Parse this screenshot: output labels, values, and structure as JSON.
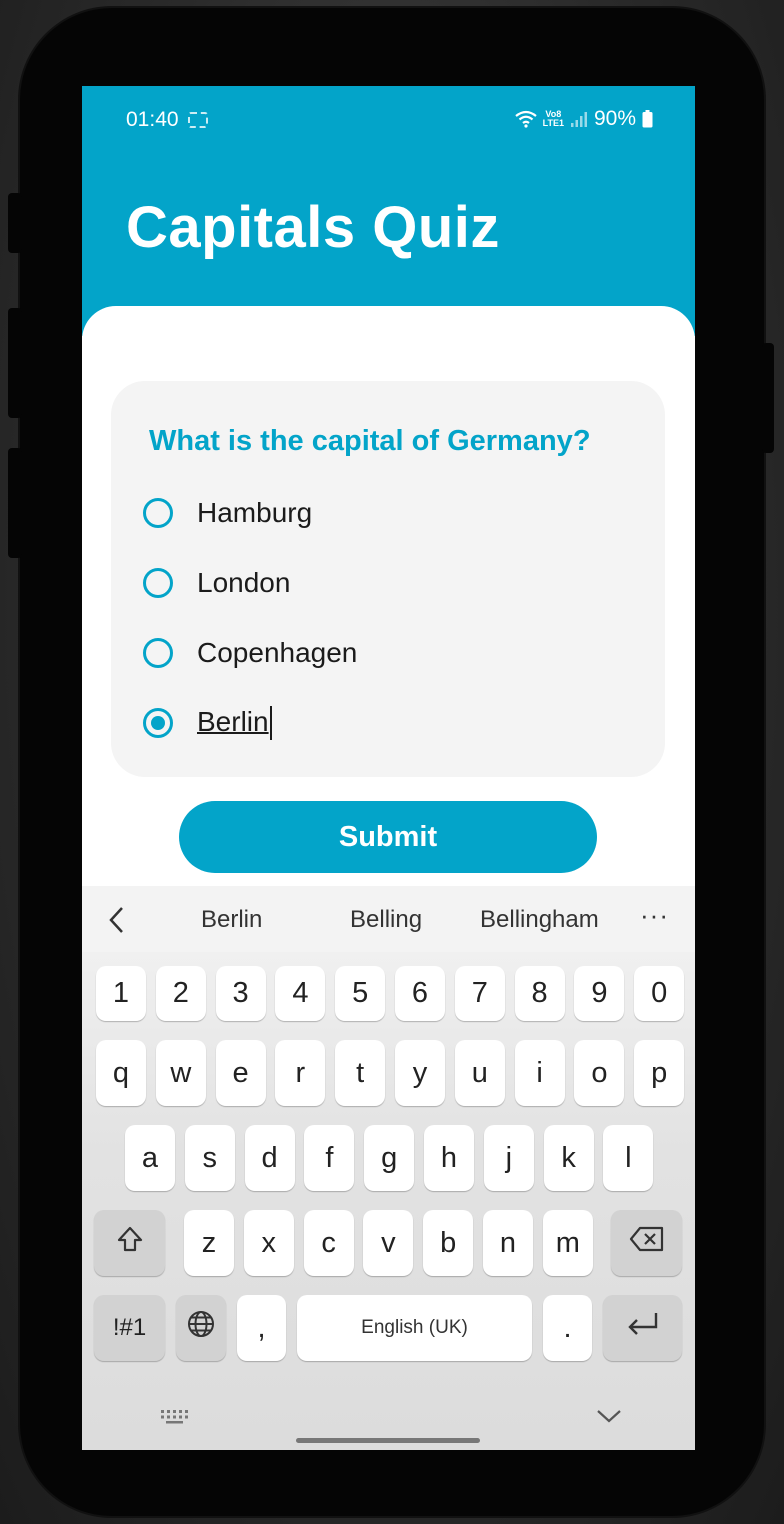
{
  "status_bar": {
    "time": "01:40",
    "volte_top": "Vo8",
    "volte_bottom": "LTE1",
    "battery": "90%"
  },
  "app": {
    "title": "Capitals Quiz",
    "accent_color": "#03a4c9"
  },
  "quiz": {
    "question": "What is the capital of Germany?",
    "options": [
      {
        "label": "Hamburg",
        "selected": false
      },
      {
        "label": "London",
        "selected": false
      },
      {
        "label": "Copenhagen",
        "selected": false
      },
      {
        "label": "Berlin",
        "selected": true
      }
    ],
    "submit_label": "Submit"
  },
  "keyboard": {
    "suggestions": [
      "Berlin",
      "Belling",
      "Bellingham"
    ],
    "more_label": "···",
    "row_numbers": [
      "1",
      "2",
      "3",
      "4",
      "5",
      "6",
      "7",
      "8",
      "9",
      "0"
    ],
    "row_top": [
      "q",
      "w",
      "e",
      "r",
      "t",
      "y",
      "u",
      "i",
      "o",
      "p"
    ],
    "row_home": [
      "a",
      "s",
      "d",
      "f",
      "g",
      "h",
      "j",
      "k",
      "l"
    ],
    "row_bottom": [
      "z",
      "x",
      "c",
      "v",
      "b",
      "n",
      "m"
    ],
    "symbols_label": "!#1",
    "comma_label": ",",
    "space_label": "English (UK)",
    "period_label": ".",
    "icons": {
      "back": "chevron-left-icon",
      "shift": "shift-icon",
      "backspace": "backspace-icon",
      "language": "globe-icon",
      "enter": "enter-icon",
      "keyboard_switch": "keyboard-icon",
      "hide": "chevron-down-icon"
    }
  }
}
